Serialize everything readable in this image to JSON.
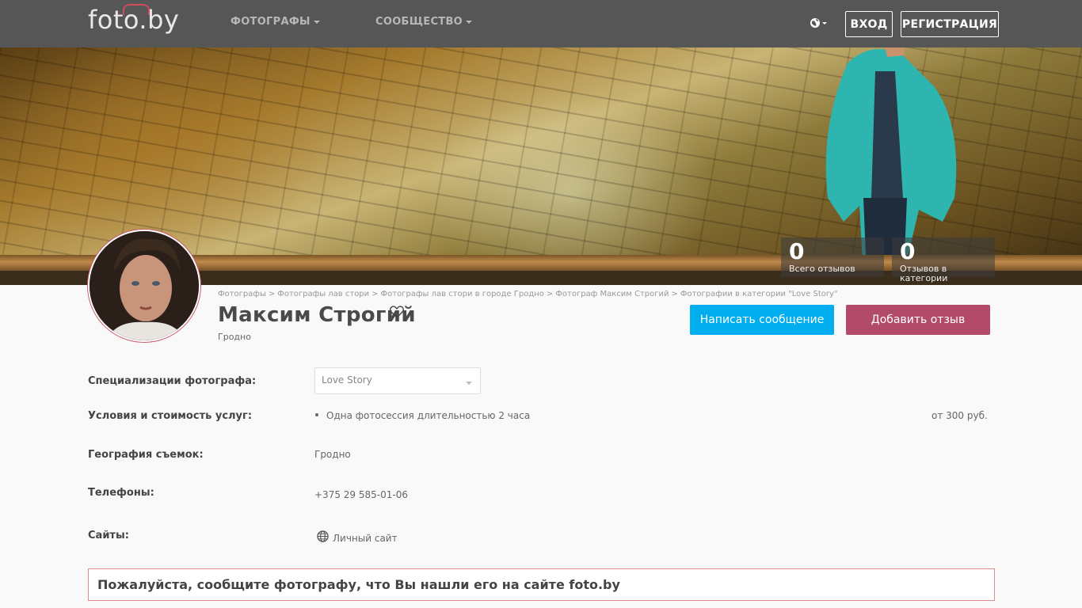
{
  "navbar": {
    "logo": "foto.by",
    "menu": [
      {
        "label": "ФОТОГРАФЫ"
      },
      {
        "label": "СООБЩЕСТВО"
      }
    ],
    "login": "ВХОД",
    "register": "РЕГИСТРАЦИЯ",
    "language_icon": "globe-icon"
  },
  "hero": {
    "stats": [
      {
        "value": "0",
        "label": "Всего отзывов"
      },
      {
        "value": "0",
        "label": "Отзывов в категории"
      }
    ]
  },
  "breadcrumb": [
    "Фотографы",
    "Фотографы лав стори",
    "Фотографы лав стори в городе Гродно",
    "Фотограф Максим Строгий",
    "Фотографии в категории \"Love Story\""
  ],
  "profile": {
    "name": "Максим Строгий",
    "city": "Гродно",
    "message_button": "Написать сообщение",
    "review_button": "Добавить отзыв"
  },
  "details": {
    "specializations_label": "Специализации фотографа:",
    "specialization_selected": "Love Story",
    "conditions_label": "Условия и стоимость услуг:",
    "service_name": "Одна фотосессия длительностью 2 часа",
    "service_price": "от 300 руб.",
    "geography_label": "География съемок:",
    "geography_value": "Гродно",
    "phones_label": "Телефоны:",
    "phone_value": "+375 29 585-01-06",
    "sites_label": "Сайты:",
    "site_value": "Личный сайт"
  },
  "notice": "Пожалуйста, сообщите фотографу, что Вы нашли его на сайте foto.by",
  "colors": {
    "navbar": "#565656",
    "message_button": "#00aeef",
    "review_button": "#b34a6a",
    "notice_border": "#e08a8a"
  }
}
